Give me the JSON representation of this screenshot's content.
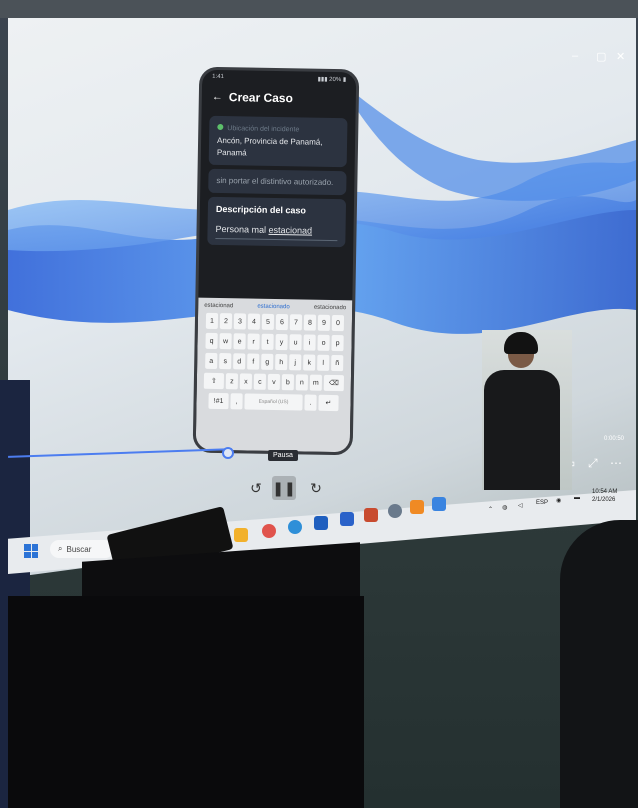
{
  "window": {
    "controls": [
      "–",
      "▢",
      "✕"
    ]
  },
  "phone": {
    "status_time": "1:41",
    "status_icons": "▮▮▮ 20% ▮",
    "title": "Crear Caso",
    "location_label": "Ubicación del incidente",
    "location_value": "Ancón, Provincia de Panamá, Panamá",
    "prev_text": "sin portar el distintivo autorizado.",
    "description_title": "Descripción del caso",
    "description_text_prefix": "Persona mal ",
    "description_text_typed": "estacionad",
    "suggestions": [
      "estacionad",
      "estacionado",
      "estacionado"
    ],
    "keyboard_rows": [
      [
        "1",
        "2",
        "3",
        "4",
        "5",
        "6",
        "7",
        "8",
        "9",
        "0"
      ],
      [
        "q",
        "w",
        "e",
        "r",
        "t",
        "y",
        "u",
        "i",
        "o",
        "p"
      ],
      [
        "a",
        "s",
        "d",
        "f",
        "g",
        "h",
        "j",
        "k",
        "l",
        "ñ"
      ],
      [
        "⇧",
        "z",
        "x",
        "c",
        "v",
        "b",
        "n",
        "m",
        "⌫"
      ],
      [
        "!#1",
        ",",
        "Español (US)",
        ".",
        "↵"
      ]
    ]
  },
  "player": {
    "tooltip": "Pausa",
    "rewind_icon": "rewind-10-icon",
    "pause_icon": "pause-icon",
    "forward_icon": "forward-10-icon",
    "timecode": "0:00:50"
  },
  "taskbar": {
    "search_placeholder": "Buscar",
    "tray_lang": "ESP",
    "tray_time": "10:54 AM",
    "tray_date": "2/1/2026"
  },
  "colors": {
    "accent": "#4c7df0",
    "start": "#2b73d6"
  }
}
